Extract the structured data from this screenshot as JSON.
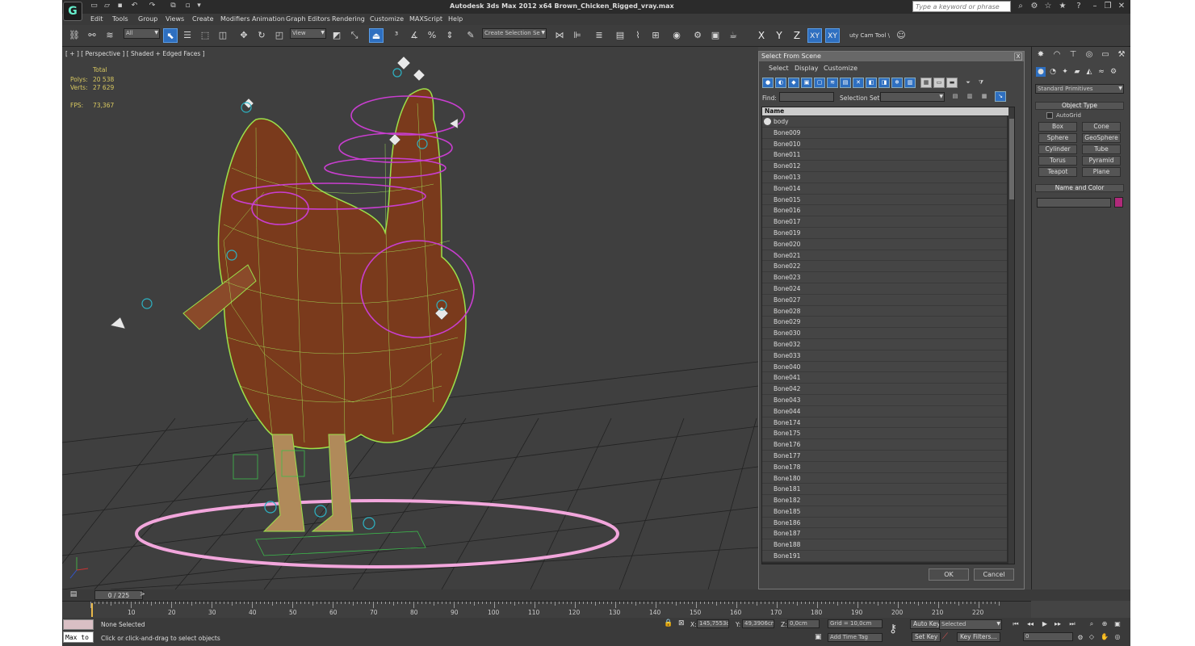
{
  "window": {
    "title": "Autodesk 3ds Max  2012 x64      Brown_Chicken_Rigged_vray.max",
    "app_icon_letter": "G",
    "search_placeholder": "Type a keyword or phrase"
  },
  "menu": [
    "Edit",
    "Tools",
    "Group",
    "Views",
    "Create",
    "Modifiers",
    "Animation",
    "Graph Editors",
    "Rendering",
    "Customize",
    "MAXScript",
    "Help"
  ],
  "toolbar": {
    "filter_value": "All",
    "refcoord_value": "View",
    "selection_set_value": "Create Selection Se",
    "axes": [
      "X",
      "Y",
      "Z",
      "XY",
      "XY"
    ],
    "cam_tool_label": "uty Cam Tool \\"
  },
  "viewport": {
    "label": "[ + ] [ Perspective ] [ Shaded + Edged Faces ]",
    "stats": {
      "total_label": "Total",
      "polys_label": "Polys:",
      "polys_value": "20 538",
      "verts_label": "Verts:",
      "verts_value": "27 629",
      "fps_label": "FPS:",
      "fps_value": "73,367"
    }
  },
  "dialog": {
    "title": "Select From Scene",
    "close": "X",
    "menus": [
      "Select",
      "Display",
      "Customize"
    ],
    "find_label": "Find:",
    "selection_set_label": "Selection Set:",
    "column_name": "Name",
    "items": [
      "body",
      "Bone009",
      "Bone010",
      "Bone011",
      "Bone012",
      "Bone013",
      "Bone014",
      "Bone015",
      "Bone016",
      "Bone017",
      "Bone019",
      "Bone020",
      "Bone021",
      "Bone022",
      "Bone023",
      "Bone024",
      "Bone027",
      "Bone028",
      "Bone029",
      "Bone030",
      "Bone032",
      "Bone033",
      "Bone040",
      "Bone041",
      "Bone042",
      "Bone043",
      "Bone044",
      "Bone174",
      "Bone175",
      "Bone176",
      "Bone177",
      "Bone178",
      "Bone180",
      "Bone181",
      "Bone182",
      "Bone185",
      "Bone186",
      "Bone187",
      "Bone188",
      "Bone191"
    ],
    "ok": "OK",
    "cancel": "Cancel"
  },
  "command_panel": {
    "category": "Standard Primitives",
    "object_type_header": "Object Type",
    "autogrid": "AutoGrid",
    "buttons": [
      "Box",
      "Cone",
      "Sphere",
      "GeoSphere",
      "Cylinder",
      "Tube",
      "Torus",
      "Pyramid",
      "Teapot",
      "Plane"
    ],
    "name_color_header": "Name and Color",
    "color": "#b02a7a"
  },
  "timeline": {
    "frame_display": "0 / 225",
    "ticks": [
      "10",
      "20",
      "30",
      "40",
      "50",
      "60",
      "70",
      "80",
      "90",
      "100",
      "110",
      "120",
      "130",
      "140",
      "150",
      "160",
      "170",
      "180",
      "190",
      "200",
      "210",
      "220"
    ]
  },
  "status": {
    "maxscript_text": "Max to",
    "selection": "None Selected",
    "prompt": "Click or click-and-drag to select objects",
    "x_label": "X:",
    "x_value": "145,7553c",
    "y_label": "Y:",
    "y_value": "49,3906cm",
    "z_label": "Z:",
    "z_value": "0,0cm",
    "grid": "Grid = 10,0cm",
    "add_time_tag": "Add Time Tag",
    "auto_key": "Auto Key",
    "selected_value": "Selected",
    "set_key": "Set Key",
    "key_filters": "Key Filters...",
    "frame_value": "0"
  }
}
